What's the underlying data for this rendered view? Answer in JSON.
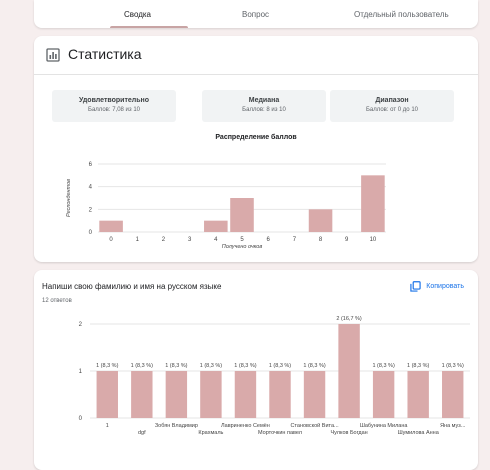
{
  "tabs": [
    "Сводка",
    "Вопрос",
    "Отдельный пользователь"
  ],
  "stats": {
    "title": "Статистика",
    "metrics": [
      {
        "label": "Удовлетворительно",
        "value": "Баллов: 7,08 из 10"
      },
      {
        "label": "Медиана",
        "value": "Баллов: 8 из 10"
      },
      {
        "label": "Диапазон",
        "value": "Баллов: от 0 до 10"
      }
    ]
  },
  "question": {
    "title": "Напиши свою фамилию и имя на русском языке",
    "responses": "12 ответов",
    "copy_label": "Копировать"
  },
  "colors": {
    "bar": "#d9aaaa",
    "accent": "#1a73e8"
  },
  "icons": {
    "stats": "bar-chart-icon",
    "copy": "copy-icon"
  },
  "chart_data": [
    {
      "type": "bar",
      "title": "Распределение баллов",
      "xlabel": "Получено очков",
      "ylabel": "Респондентов",
      "categories": [
        "0",
        "1",
        "2",
        "3",
        "4",
        "5",
        "6",
        "7",
        "8",
        "9",
        "10"
      ],
      "values": [
        1,
        0,
        0,
        0,
        1,
        3,
        0,
        0,
        2,
        0,
        5
      ],
      "ylim": [
        0,
        6
      ],
      "yticks": [
        "0",
        "2",
        "4",
        "6"
      ],
      "grid": true
    },
    {
      "type": "bar",
      "categories": [
        "1",
        "dgf",
        "Зобян Владимир",
        "Крахмаль",
        "Лавриненко Семён",
        "Морточкин павел",
        "Становской Вита...",
        "Чулков Богдан",
        "Шабунина Милана",
        "Шумилова Анна",
        "Яна муз..."
      ],
      "values": [
        1,
        1,
        1,
        1,
        1,
        1,
        1,
        2,
        1,
        1,
        1
      ],
      "data_labels": [
        "1 (8,3 %)",
        "1 (8,3 %)",
        "1 (8,3 %)",
        "1 (8,3 %)",
        "1 (8,3 %)",
        "1 (8,3 %)",
        "1 (8,3 %)",
        "2 (16,7 %)",
        "1 (8,3 %)",
        "1 (8,3 %)",
        "1 (8,3 %)"
      ],
      "ylim": [
        0,
        2
      ],
      "yticks": [
        "0",
        "1",
        "2"
      ],
      "grid": true
    }
  ]
}
